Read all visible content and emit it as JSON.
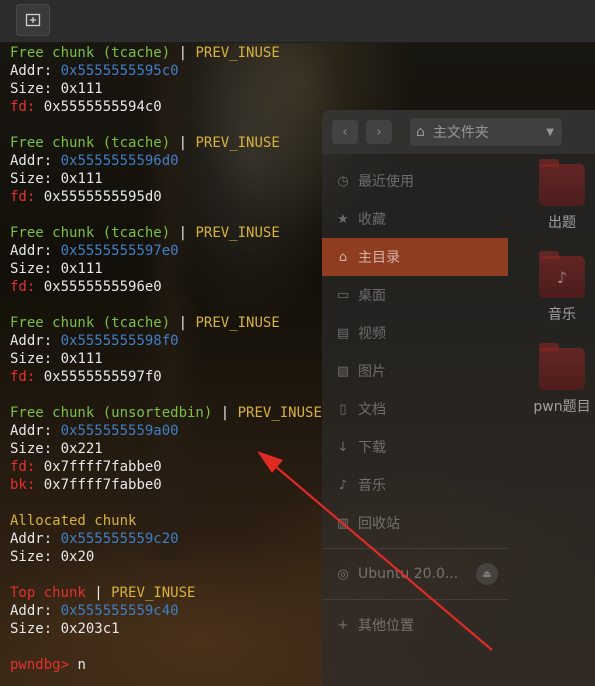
{
  "toolbar": {
    "button_icon": "new-tab-icon"
  },
  "file_manager": {
    "path_label": "主文件夹",
    "sidebar": [
      {
        "label": "最近使用",
        "icon": "clock-icon",
        "glyph": "◷"
      },
      {
        "label": "收藏",
        "icon": "star-icon",
        "glyph": "★"
      },
      {
        "label": "主目录",
        "icon": "home-icon",
        "glyph": "⌂",
        "active": true
      },
      {
        "label": "桌面",
        "icon": "desktop-icon",
        "glyph": "▭"
      },
      {
        "label": "视频",
        "icon": "video-icon",
        "glyph": "▤"
      },
      {
        "label": "图片",
        "icon": "image-icon",
        "glyph": "▨"
      },
      {
        "label": "文档",
        "icon": "document-icon",
        "glyph": "▯"
      },
      {
        "label": "下载",
        "icon": "download-icon",
        "glyph": "↓"
      },
      {
        "label": "音乐",
        "icon": "music-icon",
        "glyph": "♪"
      },
      {
        "label": "回收站",
        "icon": "trash-icon",
        "glyph": "▥"
      }
    ],
    "drive_label": "Ubuntu 20.0...",
    "other_locations": "其他位置",
    "files": [
      {
        "label": "出题",
        "icon": "folder-icon",
        "glyph": ""
      },
      {
        "label": "音乐",
        "icon": "music-folder-icon",
        "glyph": "♪"
      },
      {
        "label": "pwn题目",
        "icon": "folder-icon",
        "glyph": ""
      }
    ]
  },
  "terminal": {
    "chunks": [
      {
        "title": "Free chunk (tcache)",
        "flag": "PREV_INUSE",
        "addr": "0x5555555595c0",
        "size": "0x111",
        "fd": "0x5555555594c0"
      },
      {
        "title": "Free chunk (tcache)",
        "flag": "PREV_INUSE",
        "addr": "0x5555555596d0",
        "size": "0x111",
        "fd": "0x5555555595d0"
      },
      {
        "title": "Free chunk (tcache)",
        "flag": "PREV_INUSE",
        "addr": "0x5555555597e0",
        "size": "0x111",
        "fd": "0x5555555596e0"
      },
      {
        "title": "Free chunk (tcache)",
        "flag": "PREV_INUSE",
        "addr": "0x5555555598f0",
        "size": "0x111",
        "fd": "0x5555555597f0"
      },
      {
        "title": "Free chunk (unsortedbin)",
        "flag": "PREV_INUSE",
        "addr": "0x555555559a00",
        "size": "0x221",
        "fd": "0x7ffff7fabbe0",
        "bk": "0x7ffff7fabbe0"
      }
    ],
    "allocated": {
      "title": "Allocated chunk",
      "addr": "0x555555559c20",
      "size": "0x20"
    },
    "top": {
      "title": "Top chunk",
      "flag": "PREV_INUSE",
      "addr": "0x555555559c40",
      "size": "0x203c1"
    },
    "labels": {
      "addr": "Addr:",
      "size": "Size:",
      "fd": "fd:",
      "bk": "bk:",
      "sep": "|"
    },
    "prompt": "pwndbg>",
    "command": "n"
  },
  "annotation": {
    "color": "#e02a24",
    "shape": "red-arrow"
  }
}
